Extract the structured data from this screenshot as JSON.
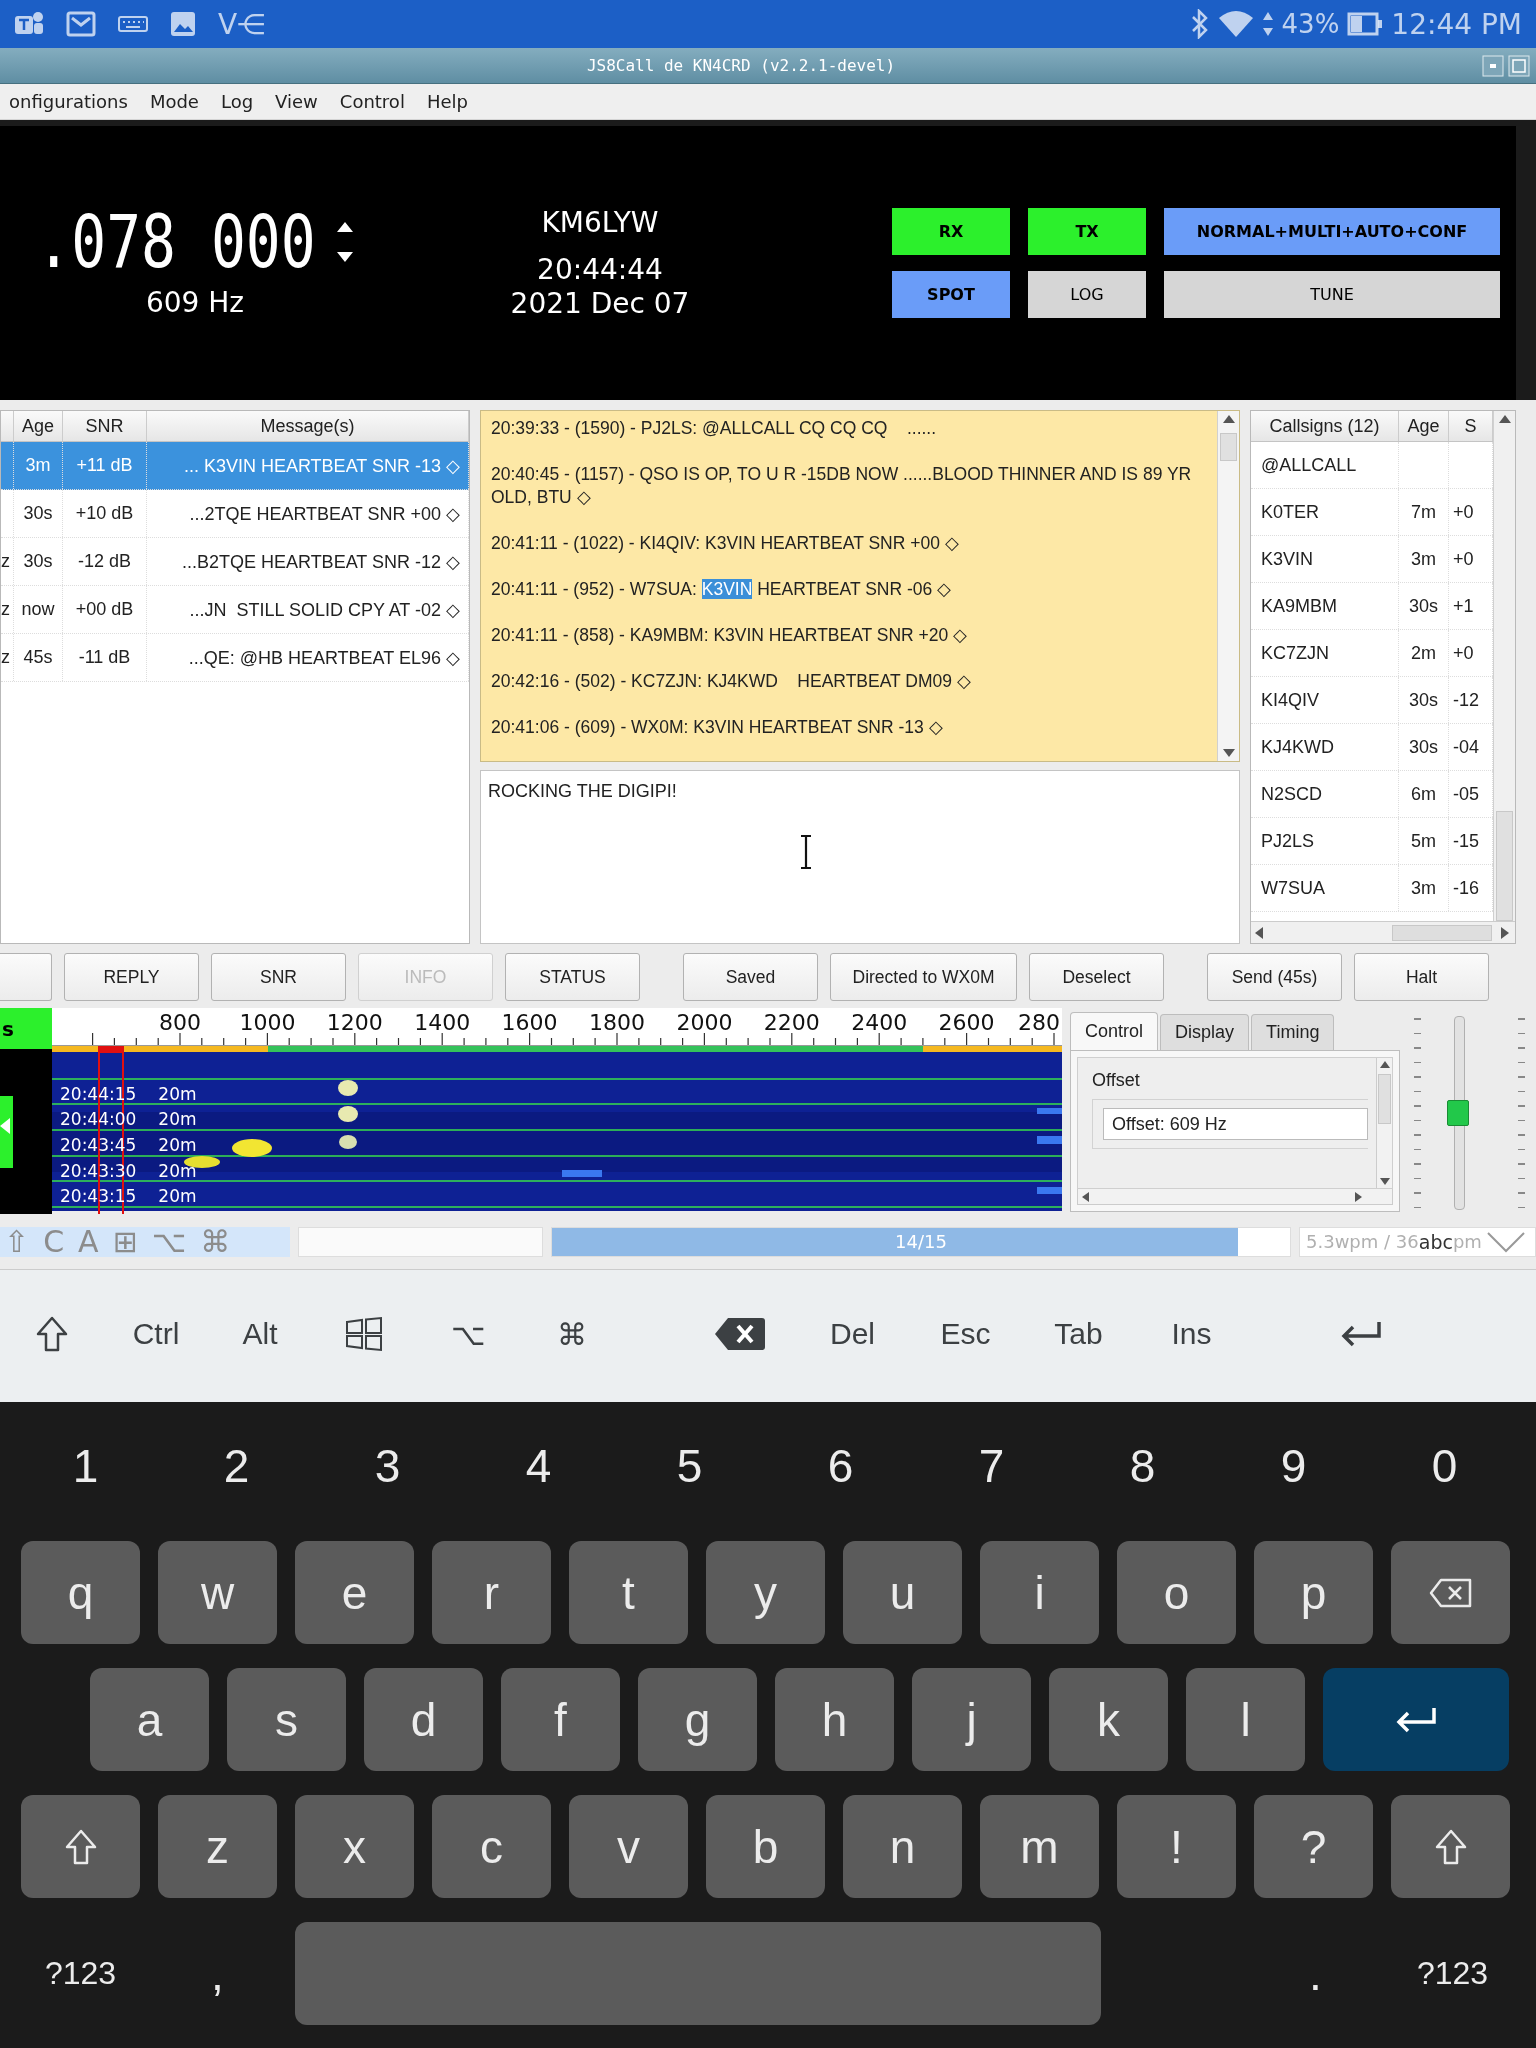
{
  "status_bar": {
    "app_label": "V⋲",
    "battery": "43%",
    "time": "12:44 PM"
  },
  "window": {
    "title": "JS8Call de KN4CRD (v2.2.1-devel)"
  },
  "menu": [
    {
      "label": "onfigurations"
    },
    {
      "label": "Mode"
    },
    {
      "label": "Log"
    },
    {
      "label": "View"
    },
    {
      "label": "Control"
    },
    {
      "label": "Help"
    }
  ],
  "header": {
    "frequency": ".078 000",
    "offset": "609 Hz",
    "callsign": "KM6LYW",
    "time": "20:44:44",
    "date": "2021 Dec 07",
    "buttons": [
      {
        "label": "RX",
        "on": true,
        "color": "#2cf02c"
      },
      {
        "label": "TX",
        "on": true,
        "color": "#2cf02c"
      },
      {
        "label": "NORMAL+MULTI+AUTO+CONF",
        "on": true,
        "color": "#6a9cf8"
      },
      {
        "label": "SPOT",
        "on": true,
        "color": "#6a9cf8"
      },
      {
        "label": "LOG",
        "on": false,
        "color": "#d6d6d6"
      },
      {
        "label": "TUNE",
        "on": false,
        "color": "#d6d6d6"
      }
    ]
  },
  "activity_table": {
    "columns": [
      "Age",
      "SNR",
      "Message(s)"
    ],
    "rows": [
      {
        "age": "3m",
        "snr": "+11 dB",
        "message": "... K3VIN HEARTBEAT SNR -13 ◇",
        "selected": true
      },
      {
        "age": "30s",
        "snr": "+10 dB",
        "message": "...2TQE HEARTBEAT SNR +00 ◇",
        "selected": false
      },
      {
        "column_1": "z",
        "age": "30s",
        "snr": "-12 dB",
        "message": "...B2TQE HEARTBEAT SNR -12 ◇",
        "selected": false
      },
      {
        "column_1": "z",
        "age": "now",
        "snr": "+00 dB",
        "message": "...JN  STILL SOLID CPY AT -02 ◇",
        "selected": false
      },
      {
        "column_1": "z",
        "age": "45s",
        "snr": "-11 dB",
        "message": "...QE: @HB HEARTBEAT EL96 ◇",
        "selected": false
      }
    ]
  },
  "log": {
    "entries": [
      {
        "segments": [
          {
            "text": "20:39:33 - (1590) - PJ2LS: @ALLCALL CQ CQ CQ    ......",
            "selected": false
          }
        ]
      },
      {
        "segments": [
          {
            "text": "20:40:45 - (1157) - QSO IS OP, TO U R -15DB NOW ......BLOOD THINNER AND IS 89 YR OLD, BTU ◇",
            "selected": false
          }
        ]
      },
      {
        "segments": [
          {
            "text": "20:41:11 - (1022) - KI4QIV: K3VIN HEARTBEAT SNR +00 ◇",
            "selected": false
          }
        ]
      },
      {
        "segments": [
          {
            "text": "20:41:11 - (952) - W7SUA: ",
            "selected": false
          },
          {
            "text": "K3VIN",
            "selected": true
          },
          {
            "text": " HEARTBEAT SNR -06 ◇",
            "selected": false
          }
        ]
      },
      {
        "segments": [
          {
            "text": "20:41:11 - (858) - KA9MBM: K3VIN HEARTBEAT SNR +20 ◇",
            "selected": false
          }
        ]
      },
      {
        "segments": [
          {
            "text": "20:42:16 - (502) - KC7ZJN: KJ4KWD    HEARTBEAT DM09 ◇",
            "selected": false
          }
        ]
      },
      {
        "segments": [
          {
            "text": "20:41:06 - (609) - WX0M: K3VIN HEARTBEAT SNR -13 ◇",
            "selected": false
          }
        ]
      }
    ]
  },
  "message_input": {
    "value": "ROCKING THE DIGIPI!"
  },
  "callsigns": {
    "columns": [
      "Callsigns (12)",
      "Age",
      "S"
    ],
    "rows": [
      {
        "callsign": "@ALLCALL"
      },
      {
        "callsign": "K0TER",
        "age": "7m",
        "snr": "+0"
      },
      {
        "callsign": "K3VIN",
        "age": "3m",
        "snr": "+0"
      },
      {
        "callsign": "KA9MBM",
        "age": "30s",
        "snr": "+1"
      },
      {
        "callsign": "KC7ZJN",
        "age": "2m",
        "snr": "+0"
      },
      {
        "callsign": "KI4QIV",
        "age": "30s",
        "snr": "-12"
      },
      {
        "callsign": "KJ4KWD",
        "age": "30s",
        "snr": "-04"
      },
      {
        "callsign": "N2SCD",
        "age": "6m",
        "snr": "-05"
      },
      {
        "callsign": "PJ2LS",
        "age": "5m",
        "snr": "-15"
      },
      {
        "callsign": "W7SUA",
        "age": "3m",
        "snr": "-16"
      }
    ]
  },
  "buttons": [
    {
      "disabled": false
    },
    {
      "label": "REPLY",
      "disabled": false
    },
    {
      "label": "SNR",
      "disabled": false
    },
    {
      "label": "INFO",
      "disabled": true
    },
    {
      "label": "STATUS",
      "disabled": false
    },
    {
      "label": "Saved",
      "disabled": false
    },
    {
      "label": "Directed to WX0M",
      "disabled": false
    },
    {
      "label": "Deselect",
      "disabled": false
    },
    {
      "label": "Send (45s)",
      "disabled": false
    },
    {
      "label": "Halt",
      "disabled": false
    }
  ],
  "waterfall": {
    "side_label": "s",
    "frequency_labels": [
      "800",
      "1000",
      "1200",
      "1400",
      "1600",
      "1800",
      "2000",
      "2200",
      "2400",
      "2600",
      "280"
    ],
    "rows": [
      {
        "time": "20:44:15",
        "band": "20m"
      },
      {
        "time": "20:44:00",
        "band": "20m"
      },
      {
        "time": "20:43:45",
        "band": "20m"
      },
      {
        "time": "20:43:30",
        "band": "20m"
      },
      {
        "time": "20:43:15",
        "band": "20m"
      }
    ]
  },
  "control_panel": {
    "tabs": [
      {
        "label": "Control",
        "selected": true
      },
      {
        "label": "Display",
        "selected": false
      },
      {
        "label": "Timing",
        "selected": false
      }
    ],
    "group_label": "Offset",
    "offset_field": "Offset: 609 Hz"
  },
  "slider": {
    "level": 0.5
  },
  "app_status": {
    "overlay_keys": [
      "⇧",
      "C",
      "A",
      "⊞",
      "⌥",
      "⌘"
    ],
    "progress": {
      "label": "14/15",
      "level": 0.93
    },
    "wpm": "5.3wpm / 36",
    "keyboard_mode": "abc",
    "wpm_tail": "pm"
  },
  "keyboard_toolbar": {
    "left": [
      {
        "kind": "shift"
      },
      {
        "kind": "text",
        "label": "Ctrl"
      },
      {
        "kind": "text",
        "label": "Alt"
      },
      {
        "kind": "windows"
      },
      {
        "kind": "text",
        "label": "⌥"
      },
      {
        "kind": "text",
        "label": "⌘"
      }
    ],
    "middle": [
      {
        "kind": "backspace"
      },
      {
        "kind": "text",
        "label": "Del"
      },
      {
        "kind": "text",
        "label": "Esc"
      },
      {
        "kind": "text",
        "label": "Tab"
      },
      {
        "kind": "text",
        "label": "Ins"
      }
    ],
    "right": [
      {
        "kind": "enter"
      }
    ]
  },
  "keyboard": {
    "number_row": [
      "1",
      "2",
      "3",
      "4",
      "5",
      "6",
      "7",
      "8",
      "9",
      "0"
    ],
    "rows": [
      [
        {
          "kind": "char",
          "label": "q"
        },
        {
          "kind": "char",
          "label": "w"
        },
        {
          "kind": "char",
          "label": "e"
        },
        {
          "kind": "char",
          "label": "r"
        },
        {
          "kind": "char",
          "label": "t"
        },
        {
          "kind": "char",
          "label": "y"
        },
        {
          "kind": "char",
          "label": "u"
        },
        {
          "kind": "char",
          "label": "i"
        },
        {
          "kind": "char",
          "label": "o"
        },
        {
          "kind": "char",
          "label": "p"
        },
        {
          "kind": "backspace"
        }
      ],
      [
        {
          "kind": "char",
          "label": "a"
        },
        {
          "kind": "char",
          "label": "s"
        },
        {
          "kind": "char",
          "label": "d"
        },
        {
          "kind": "char",
          "label": "f"
        },
        {
          "kind": "char",
          "label": "g"
        },
        {
          "kind": "char",
          "label": "h"
        },
        {
          "kind": "char",
          "label": "j"
        },
        {
          "kind": "char",
          "label": "k"
        },
        {
          "kind": "char",
          "label": "l"
        },
        {
          "kind": "enter"
        }
      ],
      [
        {
          "kind": "shift"
        },
        {
          "kind": "char",
          "label": "z"
        },
        {
          "kind": "char",
          "label": "x"
        },
        {
          "kind": "char",
          "label": "c"
        },
        {
          "kind": "char",
          "label": "v"
        },
        {
          "kind": "char",
          "label": "b"
        },
        {
          "kind": "char",
          "label": "n"
        },
        {
          "kind": "char",
          "label": "m"
        },
        {
          "kind": "char",
          "label": "!"
        },
        {
          "kind": "char",
          "label": "?"
        },
        {
          "kind": "shift"
        }
      ],
      [
        {
          "kind": "plain",
          "label": "?123"
        },
        {
          "kind": "plain",
          "label": ","
        },
        {
          "kind": "space"
        },
        "",
        "",
        "",
        "",
        "",
        "",
        {
          "kind": "plain",
          "label": "."
        },
        {
          "kind": "plain",
          "label": "?123"
        }
      ]
    ]
  }
}
